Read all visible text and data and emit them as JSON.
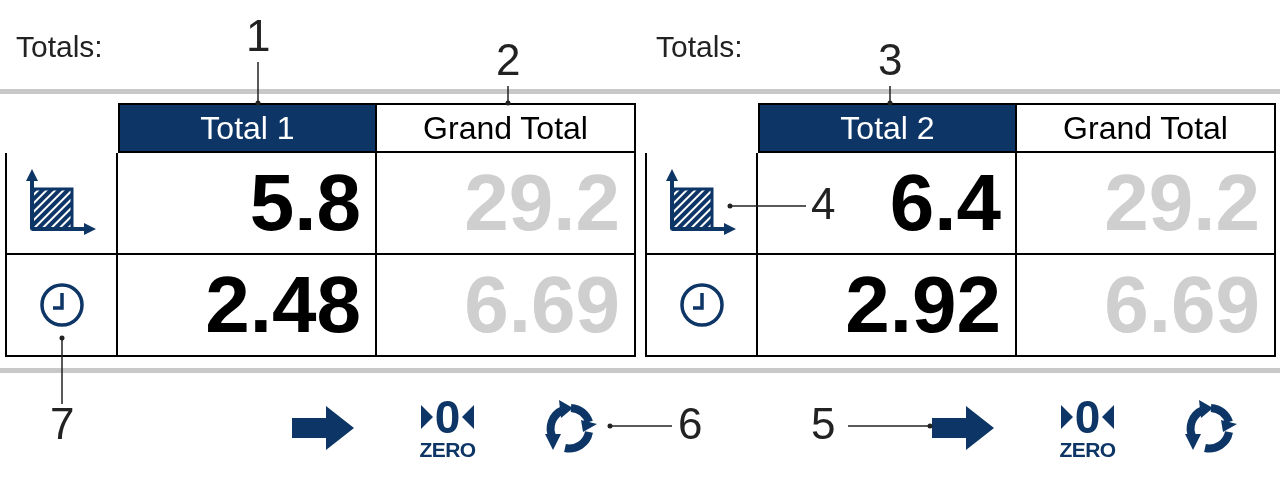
{
  "panels": [
    {
      "title": "Totals:",
      "columns": [
        {
          "label": "Total 1",
          "selected": true,
          "dimmed": false
        },
        {
          "label": "Grand Total",
          "selected": false,
          "dimmed": true
        }
      ],
      "rows": [
        {
          "kind": "area",
          "values": [
            "5.8",
            "29.2"
          ]
        },
        {
          "kind": "time",
          "values": [
            "2.48",
            "6.69"
          ]
        }
      ],
      "buttons": [
        {
          "kind": "arrow"
        },
        {
          "kind": "zero",
          "symbol": "0",
          "label": "ZERO"
        },
        {
          "kind": "reset"
        }
      ]
    },
    {
      "title": "Totals:",
      "columns": [
        {
          "label": "Total 2",
          "selected": true,
          "dimmed": false
        },
        {
          "label": "Grand Total",
          "selected": false,
          "dimmed": true
        }
      ],
      "rows": [
        {
          "kind": "area",
          "values": [
            "6.4",
            "29.2"
          ]
        },
        {
          "kind": "time",
          "values": [
            "2.92",
            "6.69"
          ]
        }
      ],
      "buttons": [
        {
          "kind": "arrow"
        },
        {
          "kind": "zero",
          "symbol": "0",
          "label": "ZERO"
        },
        {
          "kind": "reset"
        }
      ]
    }
  ],
  "callouts": [
    {
      "label": "1"
    },
    {
      "label": "2"
    },
    {
      "label": "3"
    },
    {
      "label": "4"
    },
    {
      "label": "7"
    },
    {
      "label": "6"
    },
    {
      "label": "5"
    }
  ]
}
